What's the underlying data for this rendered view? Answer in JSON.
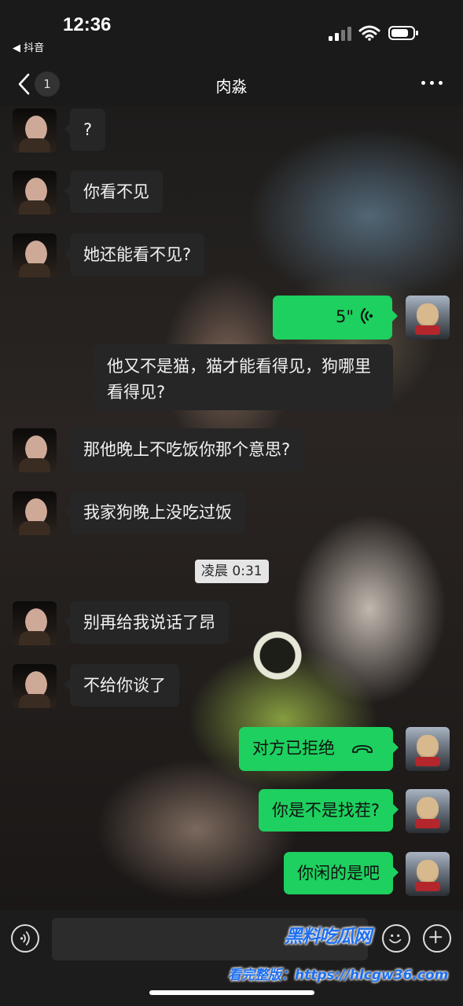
{
  "status_bar": {
    "time": "12:36",
    "back_app": "◀ 抖音"
  },
  "nav": {
    "unread_count": "1",
    "title": "肉淼"
  },
  "messages": [
    {
      "from": "them",
      "text": "?"
    },
    {
      "from": "them",
      "text": "你看不见"
    },
    {
      "from": "them",
      "text": "她还能看不见?"
    },
    {
      "from": "me",
      "type": "voice",
      "duration": "5\""
    },
    {
      "from": "me",
      "type": "transcript",
      "text": "他又不是猫，猫才能看得见，狗哪里看得见?"
    },
    {
      "from": "them",
      "text": "那他晚上不吃饭你那个意思?"
    },
    {
      "from": "them",
      "text": "我家狗晚上没吃过饭"
    },
    {
      "type": "timestamp",
      "text": "凌晨 0:31"
    },
    {
      "from": "them",
      "text": "别再给我说话了昂"
    },
    {
      "from": "them",
      "text": "不给你谈了"
    },
    {
      "from": "me",
      "type": "call",
      "text": "对方已拒绝"
    },
    {
      "from": "me",
      "text": "你是不是找茬?"
    },
    {
      "from": "me",
      "text": "你闲的是吧"
    }
  ],
  "input": {
    "value": ""
  },
  "watermark": {
    "logo": "黑料吃瓜网",
    "url": "看完整版：https://hlcgw36.com"
  },
  "colors": {
    "bubble_out": "#1ed05f",
    "bubble_in": "#262626",
    "bar": "#1c1c1c"
  }
}
